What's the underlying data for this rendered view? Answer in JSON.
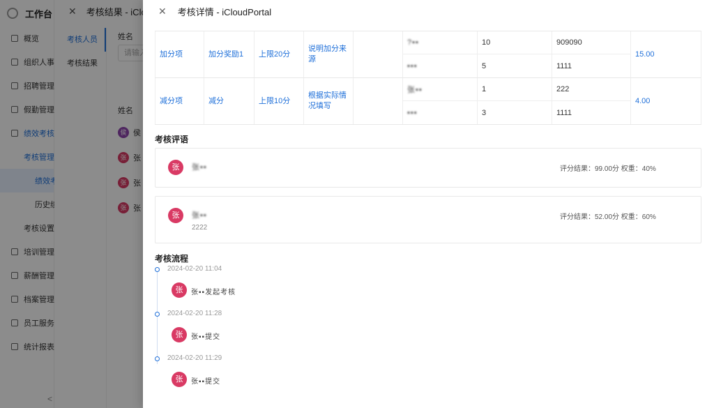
{
  "sidebar": {
    "brand": "工作台",
    "items": [
      {
        "label": "概览"
      },
      {
        "label": "组织人事"
      },
      {
        "label": "招聘管理"
      },
      {
        "label": "假勤管理"
      },
      {
        "label": "绩效考核"
      },
      {
        "label": "考核管理"
      },
      {
        "label": "绩效考"
      },
      {
        "label": "历史绩"
      },
      {
        "label": "考核设置"
      },
      {
        "label": "培训管理"
      },
      {
        "label": "薪酬管理"
      },
      {
        "label": "档案管理"
      },
      {
        "label": "员工服务"
      },
      {
        "label": "统计报表"
      }
    ],
    "collapse": "<"
  },
  "drawer1": {
    "title": "考核结果 - iClou",
    "tabs": [
      "考核人员",
      "考核结果"
    ],
    "name_label": "姓名",
    "name_placeholder": "请输入",
    "col_name": "姓名",
    "rows": [
      {
        "avatar": "侯",
        "name": "侯",
        "color": "#8e44ad"
      },
      {
        "avatar": "张",
        "name": "张",
        "color": "#d93a64"
      },
      {
        "avatar": "张",
        "name": "张",
        "color": "#d93a64"
      },
      {
        "avatar": "张",
        "name": "张",
        "color": "#d93a64"
      }
    ]
  },
  "drawer2": {
    "title": "考核详情 - iCloudPortal",
    "table": {
      "groups": [
        {
          "type": "加分项",
          "name": "加分奖励1",
          "limit": "上限20分",
          "desc": "说明加分来源",
          "total": "15.00",
          "rows": [
            {
              "person": "?▪▪",
              "score": "10",
              "remark": "909090"
            },
            {
              "person": "▪▪▪",
              "score": "5",
              "remark": "1111"
            }
          ]
        },
        {
          "type": "减分项",
          "name": "减分",
          "limit": "上限10分",
          "desc": "根据实际情况填写",
          "total": "4.00",
          "rows": [
            {
              "person": "张▪▪",
              "score": "1",
              "remark": "222"
            },
            {
              "person": "▪▪▪",
              "score": "3",
              "remark": "1111"
            }
          ]
        }
      ]
    },
    "comments_title": "考核评语",
    "comments": [
      {
        "avatar": "张",
        "name": "张▪▪",
        "content": "",
        "score": "评分结果：99.00分 权重：40%"
      },
      {
        "avatar": "张",
        "name": "张▪▪",
        "content": "2222",
        "score": "评分结果：52.00分 权重：60%"
      }
    ],
    "flow_title": "考核流程",
    "flow": [
      {
        "time": "2024-02-20 11:04",
        "avatar": "张",
        "text": "张▪▪发起考核"
      },
      {
        "time": "2024-02-20 11:28",
        "avatar": "张",
        "text": "张▪▪提交"
      },
      {
        "time": "2024-02-20 11:29",
        "avatar": "张",
        "text": "张▪▪提交"
      }
    ]
  }
}
